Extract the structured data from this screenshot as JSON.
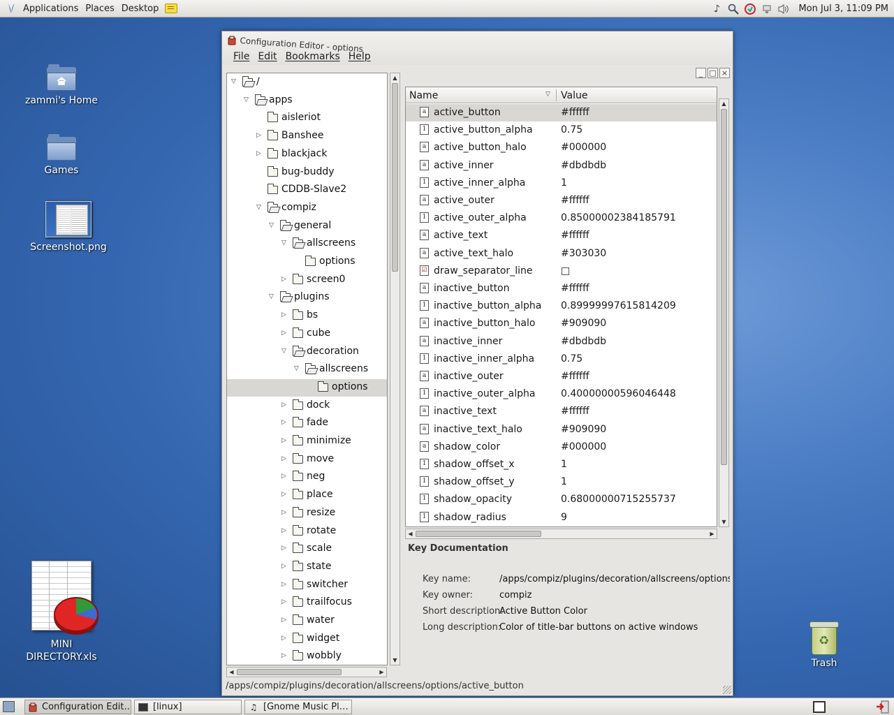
{
  "top_panel": {
    "menus": [
      "Applications",
      "Places",
      "Desktop"
    ],
    "clock": "Mon Jul  3, 11:09 PM"
  },
  "desktop": {
    "icons": [
      {
        "label": "zammi's Home"
      },
      {
        "label": "Games"
      },
      {
        "label": "Screenshot.png"
      },
      {
        "label": "MINI DIRECTORY.xls"
      },
      {
        "label": "Trash"
      }
    ]
  },
  "window": {
    "title": "Configuration Editor - options",
    "menus": [
      "File",
      "Edit",
      "Bookmarks",
      "Help"
    ],
    "tree": [
      {
        "label": "/",
        "depth": 0,
        "expander": "open",
        "folder": "open"
      },
      {
        "label": "apps",
        "depth": 1,
        "expander": "open",
        "folder": "open"
      },
      {
        "label": "aisleriot",
        "depth": 2,
        "expander": "none",
        "folder": "closed"
      },
      {
        "label": "Banshee",
        "depth": 2,
        "expander": "closed",
        "folder": "closed"
      },
      {
        "label": "blackjack",
        "depth": 2,
        "expander": "closed",
        "folder": "closed"
      },
      {
        "label": "bug-buddy",
        "depth": 2,
        "expander": "none",
        "folder": "closed"
      },
      {
        "label": "CDDB-Slave2",
        "depth": 2,
        "expander": "none",
        "folder": "closed"
      },
      {
        "label": "compiz",
        "depth": 2,
        "expander": "open",
        "folder": "open"
      },
      {
        "label": "general",
        "depth": 3,
        "expander": "open",
        "folder": "open"
      },
      {
        "label": "allscreens",
        "depth": 4,
        "expander": "open",
        "folder": "open"
      },
      {
        "label": "options",
        "depth": 5,
        "expander": "none",
        "folder": "closed"
      },
      {
        "label": "screen0",
        "depth": 4,
        "expander": "closed",
        "folder": "closed"
      },
      {
        "label": "plugins",
        "depth": 3,
        "expander": "open",
        "folder": "open"
      },
      {
        "label": "bs",
        "depth": 4,
        "expander": "closed",
        "folder": "closed"
      },
      {
        "label": "cube",
        "depth": 4,
        "expander": "closed",
        "folder": "closed"
      },
      {
        "label": "decoration",
        "depth": 4,
        "expander": "open",
        "folder": "open"
      },
      {
        "label": "allscreens",
        "depth": 5,
        "expander": "open",
        "folder": "open"
      },
      {
        "label": "options",
        "depth": 6,
        "expander": "none",
        "folder": "closed",
        "selected": true
      },
      {
        "label": "dock",
        "depth": 4,
        "expander": "closed",
        "folder": "closed"
      },
      {
        "label": "fade",
        "depth": 4,
        "expander": "closed",
        "folder": "closed"
      },
      {
        "label": "minimize",
        "depth": 4,
        "expander": "closed",
        "folder": "closed"
      },
      {
        "label": "move",
        "depth": 4,
        "expander": "closed",
        "folder": "closed"
      },
      {
        "label": "neg",
        "depth": 4,
        "expander": "closed",
        "folder": "closed"
      },
      {
        "label": "place",
        "depth": 4,
        "expander": "closed",
        "folder": "closed"
      },
      {
        "label": "resize",
        "depth": 4,
        "expander": "closed",
        "folder": "closed"
      },
      {
        "label": "rotate",
        "depth": 4,
        "expander": "closed",
        "folder": "closed"
      },
      {
        "label": "scale",
        "depth": 4,
        "expander": "closed",
        "folder": "closed"
      },
      {
        "label": "state",
        "depth": 4,
        "expander": "closed",
        "folder": "closed"
      },
      {
        "label": "switcher",
        "depth": 4,
        "expander": "closed",
        "folder": "closed"
      },
      {
        "label": "trailfocus",
        "depth": 4,
        "expander": "closed",
        "folder": "closed"
      },
      {
        "label": "water",
        "depth": 4,
        "expander": "closed",
        "folder": "closed"
      },
      {
        "label": "widget",
        "depth": 4,
        "expander": "closed",
        "folder": "closed"
      },
      {
        "label": "wobbly",
        "depth": 4,
        "expander": "closed",
        "folder": "closed"
      }
    ],
    "list_header": {
      "name": "Name",
      "value": "Value"
    },
    "keys": [
      {
        "name": "active_button",
        "type": "a",
        "value": "#ffffff",
        "selected": true
      },
      {
        "name": "active_button_alpha",
        "type": "1",
        "value": "0.75"
      },
      {
        "name": "active_button_halo",
        "type": "a",
        "value": "#000000"
      },
      {
        "name": "active_inner",
        "type": "a",
        "value": "#dbdbdb"
      },
      {
        "name": "active_inner_alpha",
        "type": "1",
        "value": "1"
      },
      {
        "name": "active_outer",
        "type": "a",
        "value": "#ffffff"
      },
      {
        "name": "active_outer_alpha",
        "type": "1",
        "value": "0.85000002384185791"
      },
      {
        "name": "active_text",
        "type": "a",
        "value": "#ffffff"
      },
      {
        "name": "active_text_halo",
        "type": "a",
        "value": "#303030"
      },
      {
        "name": "draw_separator_line",
        "type": "bool",
        "value": ""
      },
      {
        "name": "inactive_button",
        "type": "a",
        "value": "#ffffff"
      },
      {
        "name": "inactive_button_alpha",
        "type": "1",
        "value": "0.89999997615814209"
      },
      {
        "name": "inactive_button_halo",
        "type": "a",
        "value": "#909090"
      },
      {
        "name": "inactive_inner",
        "type": "a",
        "value": "#dbdbdb"
      },
      {
        "name": "inactive_inner_alpha",
        "type": "1",
        "value": "0.75"
      },
      {
        "name": "inactive_outer",
        "type": "a",
        "value": "#ffffff"
      },
      {
        "name": "inactive_outer_alpha",
        "type": "1",
        "value": "0.40000000596046448"
      },
      {
        "name": "inactive_text",
        "type": "a",
        "value": "#ffffff"
      },
      {
        "name": "inactive_text_halo",
        "type": "a",
        "value": "#909090"
      },
      {
        "name": "shadow_color",
        "type": "a",
        "value": "#000000"
      },
      {
        "name": "shadow_offset_x",
        "type": "1",
        "value": "1"
      },
      {
        "name": "shadow_offset_y",
        "type": "1",
        "value": "1"
      },
      {
        "name": "shadow_opacity",
        "type": "1",
        "value": "0.68000000715255737"
      },
      {
        "name": "shadow_radius",
        "type": "1",
        "value": "9"
      }
    ],
    "doc": {
      "title": "Key Documentation",
      "key_name_label": "Key name:",
      "key_name": "/apps/compiz/plugins/decoration/allscreens/options/ac",
      "key_owner_label": "Key owner:",
      "key_owner": "compiz",
      "short_desc_label": "Short description:",
      "short_desc": "Active Button Color",
      "long_desc_label": "Long description:",
      "long_desc": "Color of title-bar buttons on active windows"
    },
    "status": "/apps/compiz/plugins/decoration/allscreens/options/active_button"
  },
  "taskbar": {
    "tasks": [
      {
        "label": "Configuration Edit…",
        "active": true
      },
      {
        "label": "[linux]"
      },
      {
        "label": "[Gnome Music Pl…"
      }
    ]
  }
}
